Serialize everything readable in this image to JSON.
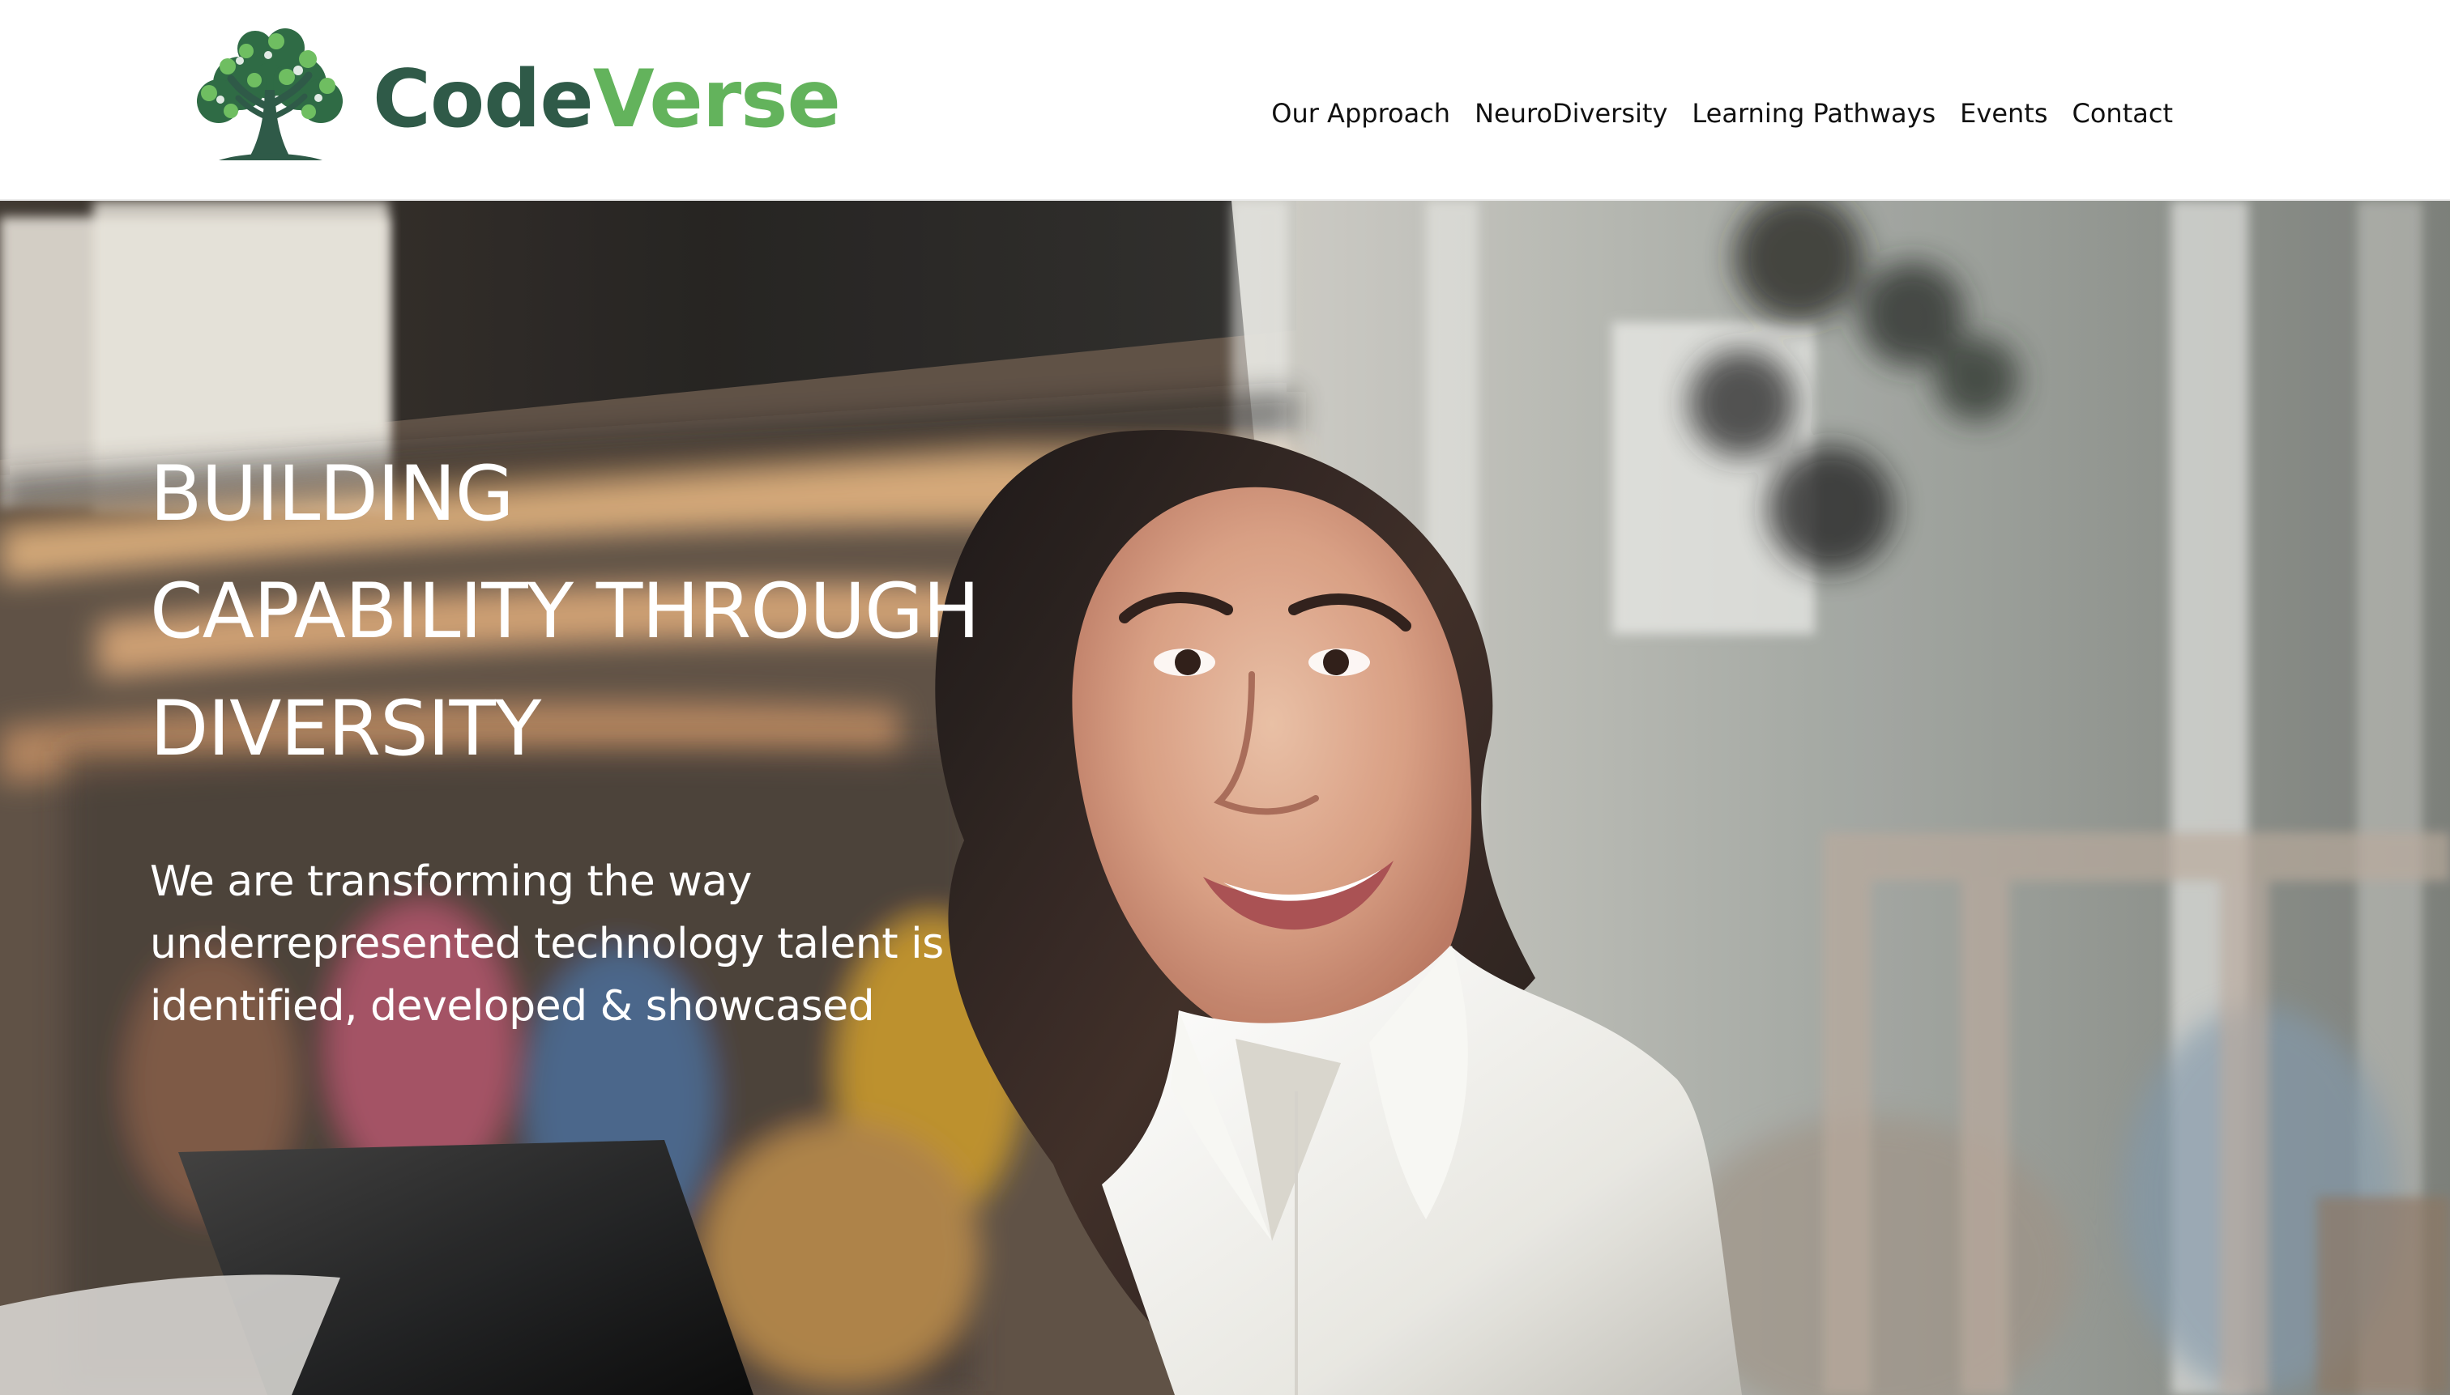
{
  "brand": {
    "name_part_1": "Code",
    "name_part_2": "Verse",
    "logo_icon": "tree-icon",
    "colors": {
      "code": "#2f5a48",
      "verse": "#63b35c"
    }
  },
  "nav": {
    "items": [
      {
        "label": "Our Approach"
      },
      {
        "label": "NeuroDiversity"
      },
      {
        "label": "Learning Pathways"
      },
      {
        "label": "Events"
      },
      {
        "label": "Contact"
      }
    ]
  },
  "hero": {
    "title_lines": [
      "BUILDING",
      "CAPABILITY THROUGH",
      "DIVERSITY"
    ],
    "subtitle_lines": [
      "We are transforming the way",
      "underrepresented technology talent is",
      "identified, developed & showcased"
    ]
  }
}
